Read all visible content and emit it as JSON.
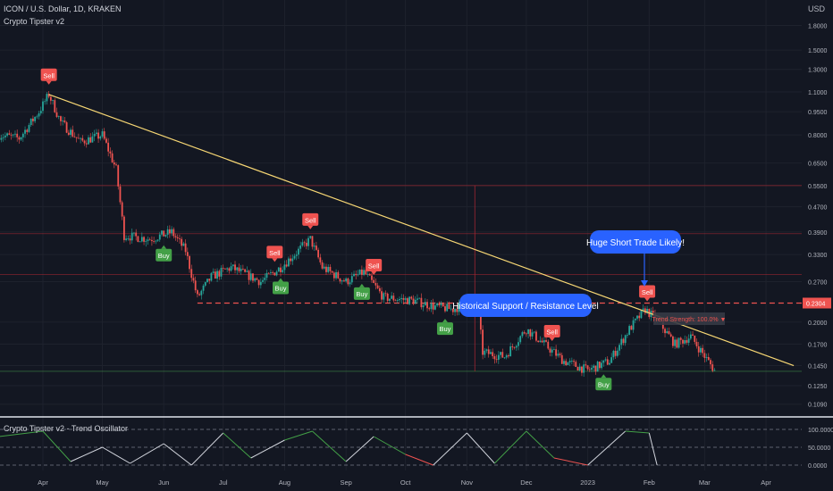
{
  "header": {
    "symbol_line": "ICON / U.S. Dollar, 1D, KRAKEN",
    "indicator_name": "Crypto Tipster v2",
    "oscillator_title": "Crypto Tipster v2 - Trend Oscillator",
    "currency": "USD"
  },
  "colors": {
    "background": "#131722",
    "up": "#26a69a",
    "down": "#ef5350",
    "trendline": "#f7d774",
    "level_line": "#ef5350",
    "buy": "#43a047",
    "sell": "#ef5350",
    "callout": "#2962ff",
    "oscillator_bull": "#43a047",
    "oscillator_bear": "#ef5350"
  },
  "chart_data": [
    {
      "type": "candlestick",
      "title": "ICON / U.S. Dollar, 1D, KRAKEN",
      "y_scale": "log",
      "ylim": [
        0.085,
        2.2
      ],
      "y_ticks": [
        "1.8000",
        "1.5000",
        "1.3000",
        "1.1000",
        "0.9500",
        "0.8000",
        "0.6500",
        "0.5500",
        "0.4700",
        "0.3900",
        "0.3300",
        "0.2700",
        "0.2000",
        "0.1700",
        "0.1450",
        "0.1250",
        "0.1090"
      ],
      "x_ticks": [
        "Apr",
        "May",
        "Jun",
        "Jul",
        "Aug",
        "Sep",
        "Oct",
        "Nov",
        "Dec",
        "2023",
        "Feb",
        "Mar",
        "Apr"
      ],
      "current_price_label": "0.2304",
      "price_path": [
        {
          "date": "2022-03-10",
          "price": 0.8
        },
        {
          "date": "2022-03-20",
          "price": 0.78
        },
        {
          "date": "2022-03-30",
          "price": 0.95
        },
        {
          "date": "2022-04-04",
          "price": 1.08
        },
        {
          "date": "2022-04-10",
          "price": 0.88
        },
        {
          "date": "2022-04-20",
          "price": 0.76
        },
        {
          "date": "2022-05-01",
          "price": 0.8
        },
        {
          "date": "2022-05-08",
          "price": 0.62
        },
        {
          "date": "2022-05-12",
          "price": 0.38
        },
        {
          "date": "2022-05-25",
          "price": 0.37
        },
        {
          "date": "2022-06-05",
          "price": 0.39
        },
        {
          "date": "2022-06-12",
          "price": 0.34
        },
        {
          "date": "2022-06-18",
          "price": 0.24
        },
        {
          "date": "2022-06-25",
          "price": 0.28
        },
        {
          "date": "2022-07-05",
          "price": 0.3
        },
        {
          "date": "2022-07-20",
          "price": 0.27
        },
        {
          "date": "2022-07-30",
          "price": 0.3
        },
        {
          "date": "2022-08-14",
          "price": 0.37
        },
        {
          "date": "2022-08-20",
          "price": 0.3
        },
        {
          "date": "2022-09-01",
          "price": 0.27
        },
        {
          "date": "2022-09-10",
          "price": 0.29
        },
        {
          "date": "2022-09-20",
          "price": 0.24
        },
        {
          "date": "2022-10-05",
          "price": 0.235
        },
        {
          "date": "2022-10-15",
          "price": 0.225
        },
        {
          "date": "2022-10-25",
          "price": 0.22
        },
        {
          "date": "2022-11-06",
          "price": 0.24
        },
        {
          "date": "2022-11-09",
          "price": 0.16
        },
        {
          "date": "2022-11-20",
          "price": 0.155
        },
        {
          "date": "2022-12-01",
          "price": 0.19
        },
        {
          "date": "2022-12-10",
          "price": 0.17
        },
        {
          "date": "2022-12-20",
          "price": 0.15
        },
        {
          "date": "2023-01-01",
          "price": 0.14
        },
        {
          "date": "2023-01-12",
          "price": 0.15
        },
        {
          "date": "2023-01-22",
          "price": 0.19
        },
        {
          "date": "2023-01-30",
          "price": 0.22
        },
        {
          "date": "2023-02-06",
          "price": 0.2
        },
        {
          "date": "2023-02-14",
          "price": 0.17
        },
        {
          "date": "2023-02-22",
          "price": 0.18
        },
        {
          "date": "2023-03-06",
          "price": 0.14
        }
      ],
      "horizontal_levels": [
        0.55,
        0.385,
        0.285,
        0.2304,
        0.139
      ],
      "trendline": [
        {
          "date": "2022-04-04",
          "price": 1.08
        },
        {
          "date": "2023-04-15",
          "price": 0.145
        }
      ],
      "signals": [
        {
          "label": "Sell",
          "date": "2022-04-04"
        },
        {
          "label": "Sell",
          "date": "2022-07-27"
        },
        {
          "label": "Sell",
          "date": "2022-08-14"
        },
        {
          "label": "Sell",
          "date": "2022-09-15"
        },
        {
          "label": "Sell",
          "date": "2022-12-14"
        },
        {
          "label": "Sell",
          "date": "2023-01-31"
        },
        {
          "label": "Buy",
          "date": "2022-06-01"
        },
        {
          "label": "Buy",
          "date": "2022-07-30"
        },
        {
          "label": "Buy",
          "date": "2022-09-09"
        },
        {
          "label": "Buy",
          "date": "2022-10-21"
        },
        {
          "label": "Buy",
          "date": "2023-01-09"
        }
      ],
      "annotations": [
        {
          "text": "Huge Short Trade Likely!"
        },
        {
          "text": "Historical Support / Resistance Level"
        },
        {
          "text": "Trend Strength: 100.0% ▼"
        }
      ]
    },
    {
      "type": "line",
      "title": "Crypto Tipster v2 - Trend Oscillator",
      "ylim": [
        0,
        100
      ],
      "y_ticks": [
        "100.0000",
        "50.0000",
        "0.0000"
      ],
      "series": [
        {
          "values": [
            {
              "date": "2022-03-10",
              "value": 80
            },
            {
              "date": "2022-04-01",
              "value": 95
            },
            {
              "date": "2022-04-15",
              "value": 10
            },
            {
              "date": "2022-05-01",
              "value": 50
            },
            {
              "date": "2022-05-15",
              "value": 5
            },
            {
              "date": "2022-06-01",
              "value": 60
            },
            {
              "date": "2022-06-15",
              "value": 0
            },
            {
              "date": "2022-07-01",
              "value": 90
            },
            {
              "date": "2022-07-15",
              "value": 20
            },
            {
              "date": "2022-08-01",
              "value": 70
            },
            {
              "date": "2022-08-15",
              "value": 95
            },
            {
              "date": "2022-09-01",
              "value": 10
            },
            {
              "date": "2022-09-15",
              "value": 80
            },
            {
              "date": "2022-10-01",
              "value": 30
            },
            {
              "date": "2022-10-15",
              "value": 0
            },
            {
              "date": "2022-11-01",
              "value": 90
            },
            {
              "date": "2022-11-15",
              "value": 5
            },
            {
              "date": "2022-12-01",
              "value": 95
            },
            {
              "date": "2022-12-15",
              "value": 20
            },
            {
              "date": "2023-01-01",
              "value": 0
            },
            {
              "date": "2023-01-20",
              "value": 95
            },
            {
              "date": "2023-02-01",
              "value": 90
            },
            {
              "date": "2023-02-05",
              "value": 0
            }
          ]
        }
      ]
    }
  ]
}
